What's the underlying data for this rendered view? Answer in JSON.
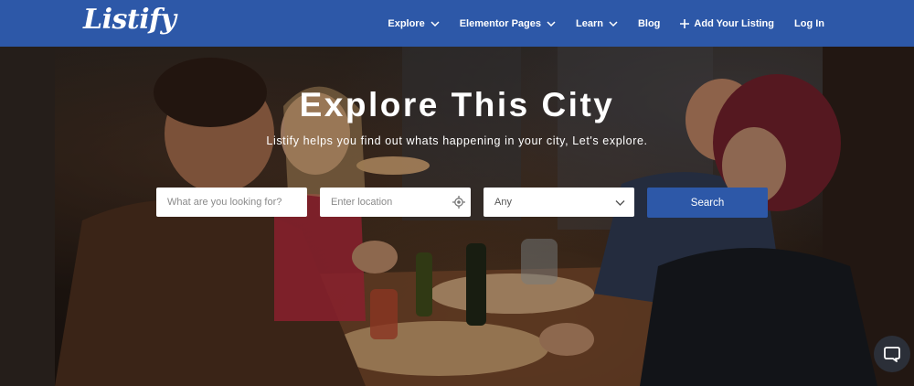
{
  "brand": {
    "logo_text": "Listify"
  },
  "nav": {
    "items": [
      {
        "label": "Explore",
        "has_dropdown": true
      },
      {
        "label": "Elementor Pages",
        "has_dropdown": true
      },
      {
        "label": "Learn",
        "has_dropdown": true
      },
      {
        "label": "Blog",
        "has_dropdown": false
      },
      {
        "label": "Add Your Listing",
        "icon": "plus-icon"
      },
      {
        "label": "Log In",
        "has_dropdown": false
      }
    ]
  },
  "hero": {
    "title": "Explore This City",
    "subtitle": "Listify helps you find out whats happening in your city, Let's explore."
  },
  "search": {
    "keyword_placeholder": "What are you looking for?",
    "location_placeholder": "Enter location",
    "category_value": "Any",
    "button_label": "Search"
  },
  "colors": {
    "brand_blue": "#2d58a8",
    "white": "#ffffff"
  }
}
